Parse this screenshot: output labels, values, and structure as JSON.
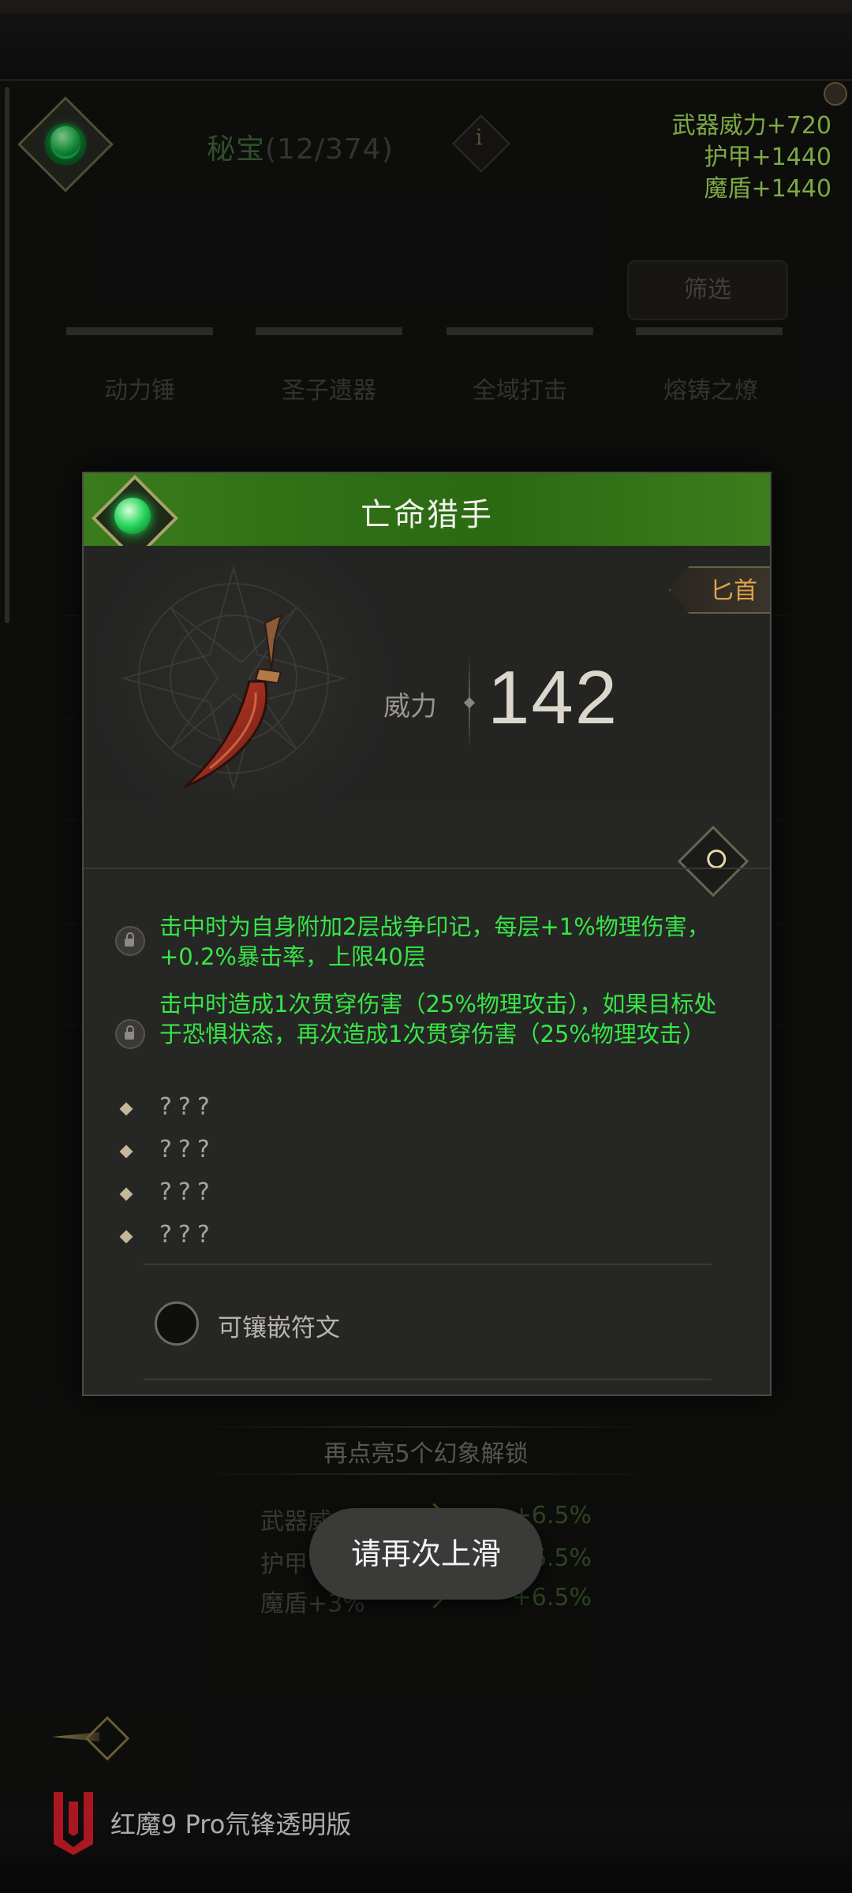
{
  "base": {
    "title": "秘宝",
    "count": "(12/374)",
    "info_glyph": "i",
    "stats": [
      "武器威力+720",
      "护甲+1440",
      "魔盾+1440"
    ],
    "filter_label": "筛选",
    "categories": [
      "动力锤",
      "圣子遗器",
      "全域打击",
      "熔铸之燎"
    ],
    "unlock_title": "再点亮5个幻象解锁",
    "bonuses": [
      {
        "left": "武器威力+3%",
        "right": "+6.5%"
      },
      {
        "left": "护甲+3%",
        "right": "+6.5%"
      },
      {
        "left": "魔盾+3%",
        "right": "+6.5%"
      }
    ]
  },
  "card": {
    "title": "亡命猎手",
    "type_tag": "匕首",
    "power_label": "威力",
    "power_value": "142",
    "affixes": [
      "击中时为自身附加2层战争印记，每层+1%物理伤害，+0.2%暴击率，上限40层",
      "击中时造成1次贯穿伤害（25%物理攻击），如果目标处于恐惧状态，再次造成1次贯穿伤害（25%物理攻击）"
    ],
    "unknown_affixes": [
      "???",
      "???",
      "???",
      "???"
    ],
    "rune_label": "可镶嵌符文"
  },
  "toast": "请再次上滑",
  "branding": {
    "text": "红魔9 Pro氘锋透明版"
  },
  "icons": {
    "emblem": "green-gem-emblem-icon",
    "info": "info-icon",
    "magnifier": "magnifier-icon",
    "lock": "lock-icon",
    "back": "back-arrow-icon",
    "brand": "red-magic-logo-icon"
  },
  "colors": {
    "affix_green": "#37e646",
    "stat_green": "#a6e25a",
    "header_green": "#2e6e15",
    "tag_orange": "#e3a24a"
  }
}
